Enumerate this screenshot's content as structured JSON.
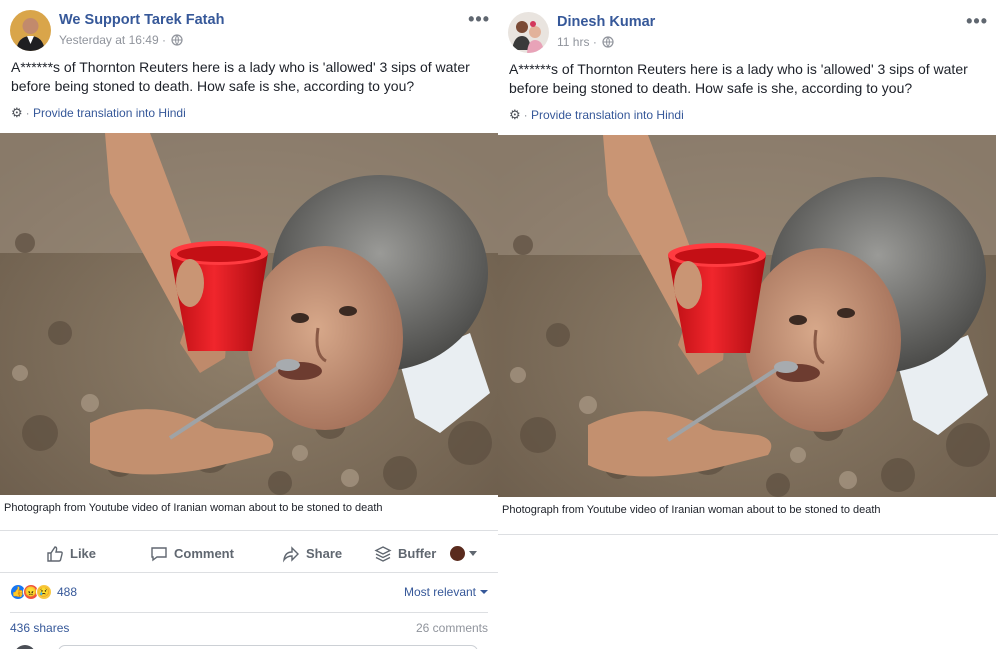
{
  "left_post": {
    "author": "We Support Tarek Fatah",
    "timestamp": "Yesterday at 16:49",
    "text": "A******s of Thornton Reuters here is a lady who is 'allowed' 3 sips of water before being stoned to death. How safe is she, according to you?",
    "translate_link": "Provide translation into Hindi",
    "caption": "Photograph from Youtube video of Iranian woman about to be stoned to death",
    "actions": {
      "like": "Like",
      "comment": "Comment",
      "share": "Share",
      "buffer": "Buffer"
    },
    "reaction_count": "488",
    "sort_label": "Most relevant",
    "shares": "436 shares",
    "comments": "26 comments"
  },
  "right_post": {
    "author": "Dinesh Kumar",
    "timestamp": "11 hrs",
    "text": "A******s of Thornton Reuters here is a lady who is 'allowed' 3 sips of water before being stoned to death. How safe is she, according to you?",
    "translate_link": "Provide translation into Hindi",
    "caption": "Photograph from Youtube video of Iranian woman about to be stoned to death"
  },
  "icons": [
    "globe-icon",
    "more-options-icon",
    "gear-icon",
    "like-icon",
    "comment-icon",
    "share-icon",
    "buffer-icon",
    "chevron-down-icon"
  ],
  "colors": {
    "link_blue": "#365899",
    "meta_gray": "#90949c",
    "like_blue": "#1877f2",
    "cup_red": "#e8141b"
  }
}
